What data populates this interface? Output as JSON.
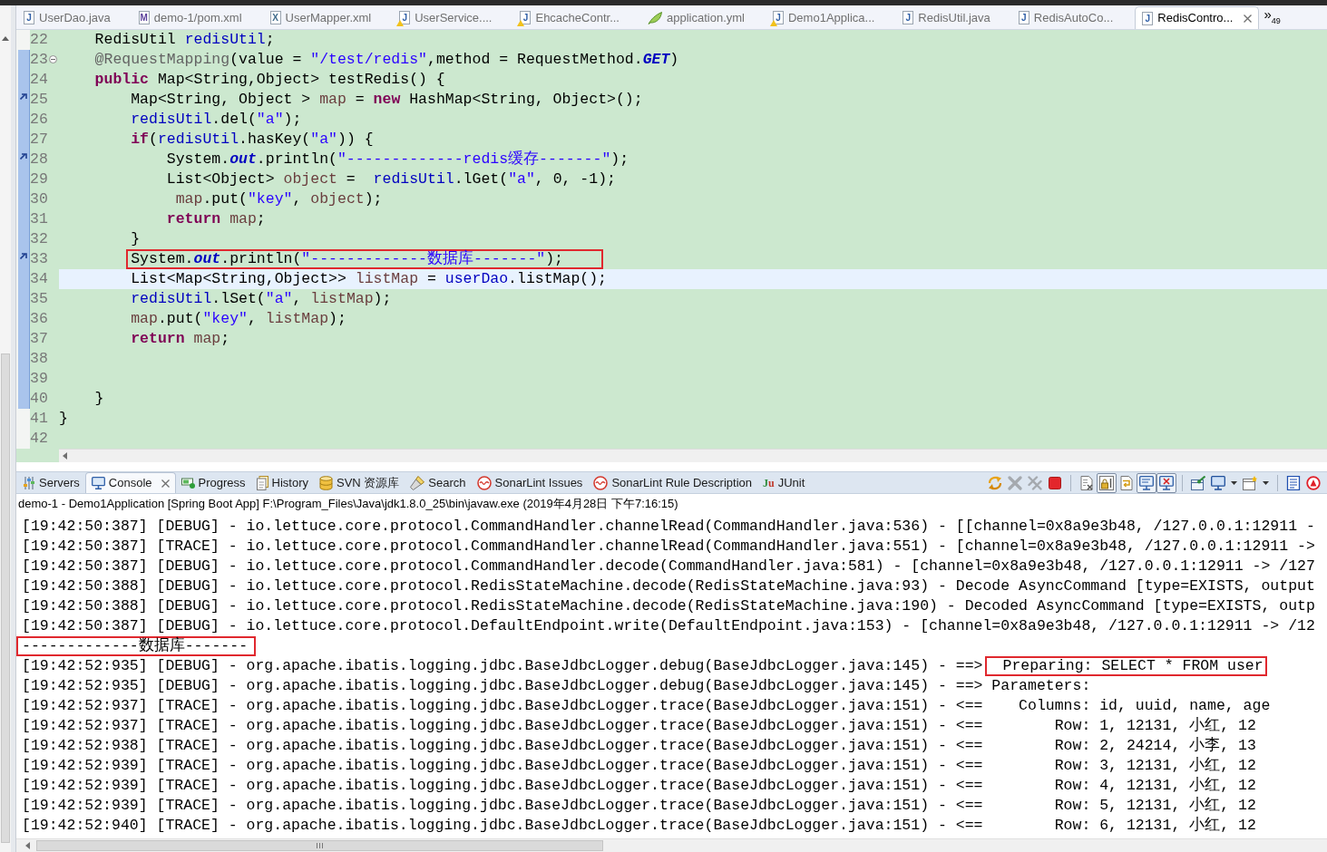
{
  "editor_tabs": [
    {
      "label": "UserDao.java",
      "kind": "java",
      "icon_letter": "J",
      "warning": false,
      "selected": false
    },
    {
      "label": "demo-1/pom.xml",
      "kind": "maven",
      "icon_letter": "M",
      "warning": false,
      "selected": false
    },
    {
      "label": "UserMapper.xml",
      "kind": "xml",
      "icon_letter": "X",
      "warning": false,
      "selected": false
    },
    {
      "label": "UserService....",
      "kind": "java",
      "icon_letter": "J",
      "warning": true,
      "selected": false
    },
    {
      "label": "EhcacheContr...",
      "kind": "java",
      "icon_letter": "J",
      "warning": true,
      "selected": false
    },
    {
      "label": "application.yml",
      "kind": "yaml",
      "warning": false,
      "selected": false
    },
    {
      "label": "Demo1Applica...",
      "kind": "java",
      "icon_letter": "J",
      "warning": true,
      "selected": false
    },
    {
      "label": "RedisUtil.java",
      "kind": "java",
      "icon_letter": "J",
      "warning": false,
      "selected": false
    },
    {
      "label": "RedisAutoCo...",
      "kind": "java",
      "icon_letter": "J",
      "warning": false,
      "selected": false
    },
    {
      "label": "RedisContro...",
      "kind": "java",
      "icon_letter": "J",
      "warning": false,
      "selected": true
    }
  ],
  "tab_overflow": {
    "symbol": "»",
    "count": "49"
  },
  "editor": {
    "lines": [
      {
        "number": "22",
        "kind": "plain",
        "changed": false,
        "current": false,
        "boxed": false,
        "tokens": [
          {
            "kind": "plain",
            "text": "    RedisUtil "
          },
          {
            "kind": "field",
            "text": "redisUtil"
          },
          {
            "kind": "plain",
            "text": ";"
          }
        ]
      },
      {
        "number": "23",
        "kind": "fold",
        "changed": true,
        "current": false,
        "boxed": false,
        "tokens": [
          {
            "kind": "annotation",
            "text": "    @RequestMapping"
          },
          {
            "kind": "plain",
            "text": "(value = "
          },
          {
            "kind": "string",
            "text": "\"/test/redis\""
          },
          {
            "kind": "plain",
            "text": ",method = RequestMethod."
          },
          {
            "kind": "static",
            "text": "GET"
          },
          {
            "kind": "plain",
            "text": ")"
          }
        ]
      },
      {
        "number": "24",
        "kind": "plain",
        "changed": true,
        "current": false,
        "boxed": false,
        "tokens": [
          {
            "kind": "keyword",
            "text": "    public"
          },
          {
            "kind": "plain",
            "text": " Map<String,Object> testRedis() {"
          }
        ]
      },
      {
        "number": "25",
        "kind": "arrow",
        "changed": true,
        "current": false,
        "boxed": false,
        "tokens": [
          {
            "kind": "plain",
            "text": "        Map<String, Object > "
          },
          {
            "kind": "local",
            "text": "map"
          },
          {
            "kind": "plain",
            "text": " = "
          },
          {
            "kind": "keyword",
            "text": "new"
          },
          {
            "kind": "plain",
            "text": " HashMap<String, Object>();"
          }
        ]
      },
      {
        "number": "26",
        "kind": "plain",
        "changed": true,
        "current": false,
        "boxed": false,
        "tokens": [
          {
            "kind": "field",
            "text": "        redisUtil"
          },
          {
            "kind": "plain",
            "text": ".del("
          },
          {
            "kind": "string",
            "text": "\"a\""
          },
          {
            "kind": "plain",
            "text": ");"
          }
        ]
      },
      {
        "number": "27",
        "kind": "plain",
        "changed": true,
        "current": false,
        "boxed": false,
        "tokens": [
          {
            "kind": "keyword",
            "text": "        if"
          },
          {
            "kind": "plain",
            "text": "("
          },
          {
            "kind": "field",
            "text": "redisUtil"
          },
          {
            "kind": "plain",
            "text": ".hasKey("
          },
          {
            "kind": "string",
            "text": "\"a\""
          },
          {
            "kind": "plain",
            "text": ")) {"
          }
        ]
      },
      {
        "number": "28",
        "kind": "arrow",
        "changed": true,
        "current": false,
        "boxed": false,
        "tokens": [
          {
            "kind": "plain",
            "text": "            System."
          },
          {
            "kind": "static",
            "text": "out"
          },
          {
            "kind": "plain",
            "text": ".println("
          },
          {
            "kind": "string",
            "text": "\"-------------redis缓存-------\""
          },
          {
            "kind": "plain",
            "text": ");"
          }
        ]
      },
      {
        "number": "29",
        "kind": "plain",
        "changed": true,
        "current": false,
        "boxed": false,
        "tokens": [
          {
            "kind": "plain",
            "text": "            List<Object> "
          },
          {
            "kind": "local",
            "text": "object"
          },
          {
            "kind": "plain",
            "text": " =  "
          },
          {
            "kind": "field",
            "text": "redisUtil"
          },
          {
            "kind": "plain",
            "text": ".lGet("
          },
          {
            "kind": "string",
            "text": "\"a\""
          },
          {
            "kind": "plain",
            "text": ", 0, -1);"
          }
        ]
      },
      {
        "number": "30",
        "kind": "plain",
        "changed": true,
        "current": false,
        "boxed": false,
        "tokens": [
          {
            "kind": "local",
            "text": "             map"
          },
          {
            "kind": "plain",
            "text": ".put("
          },
          {
            "kind": "string",
            "text": "\"key\""
          },
          {
            "kind": "plain",
            "text": ", "
          },
          {
            "kind": "local",
            "text": "object"
          },
          {
            "kind": "plain",
            "text": ");"
          }
        ]
      },
      {
        "number": "31",
        "kind": "plain",
        "changed": true,
        "current": false,
        "boxed": false,
        "tokens": [
          {
            "kind": "keyword",
            "text": "            return"
          },
          {
            "kind": "local",
            "text": " map"
          },
          {
            "kind": "plain",
            "text": ";"
          }
        ]
      },
      {
        "number": "32",
        "kind": "plain",
        "changed": true,
        "current": false,
        "boxed": false,
        "tokens": [
          {
            "kind": "plain",
            "text": "        }"
          }
        ]
      },
      {
        "number": "33",
        "kind": "arrow",
        "changed": true,
        "current": false,
        "boxed": true,
        "tokens": [
          {
            "kind": "plain",
            "text": "        System."
          },
          {
            "kind": "static",
            "text": "out"
          },
          {
            "kind": "plain",
            "text": ".println("
          },
          {
            "kind": "string",
            "text": "\"-------------数据库-------\""
          },
          {
            "kind": "plain",
            "text": ");"
          }
        ]
      },
      {
        "number": "34",
        "kind": "plain",
        "changed": true,
        "current": true,
        "boxed": false,
        "tokens": [
          {
            "kind": "plain",
            "text": "        List<Map<String,Object>> "
          },
          {
            "kind": "local",
            "text": "listMap"
          },
          {
            "kind": "plain",
            "text": " = "
          },
          {
            "kind": "field",
            "text": "userDao"
          },
          {
            "kind": "plain",
            "text": ".listMap();"
          }
        ]
      },
      {
        "number": "35",
        "kind": "plain",
        "changed": true,
        "current": false,
        "boxed": false,
        "tokens": [
          {
            "kind": "field",
            "text": "        redisUtil"
          },
          {
            "kind": "plain",
            "text": ".lSet("
          },
          {
            "kind": "string",
            "text": "\"a\""
          },
          {
            "kind": "plain",
            "text": ", "
          },
          {
            "kind": "local",
            "text": "listMap"
          },
          {
            "kind": "plain",
            "text": ");"
          }
        ]
      },
      {
        "number": "36",
        "kind": "plain",
        "changed": true,
        "current": false,
        "boxed": false,
        "tokens": [
          {
            "kind": "local",
            "text": "        map"
          },
          {
            "kind": "plain",
            "text": ".put("
          },
          {
            "kind": "string",
            "text": "\"key\""
          },
          {
            "kind": "plain",
            "text": ", "
          },
          {
            "kind": "local",
            "text": "listMap"
          },
          {
            "kind": "plain",
            "text": ");"
          }
        ]
      },
      {
        "number": "37",
        "kind": "plain",
        "changed": true,
        "current": false,
        "boxed": false,
        "tokens": [
          {
            "kind": "keyword",
            "text": "        return"
          },
          {
            "kind": "local",
            "text": " map"
          },
          {
            "kind": "plain",
            "text": ";"
          }
        ]
      },
      {
        "number": "38",
        "kind": "plain",
        "changed": true,
        "current": false,
        "boxed": false
      },
      {
        "number": "39",
        "kind": "plain",
        "changed": true,
        "current": false,
        "boxed": false
      },
      {
        "number": "40",
        "kind": "plain",
        "changed": true,
        "current": false,
        "boxed": false,
        "tokens": [
          {
            "kind": "plain",
            "text": "    }"
          }
        ]
      },
      {
        "number": "41",
        "kind": "plain",
        "changed": false,
        "current": false,
        "boxed": false,
        "tokens": [
          {
            "kind": "plain",
            "text": "}"
          }
        ]
      },
      {
        "number": "42",
        "kind": "plain",
        "changed": false,
        "current": false,
        "boxed": false
      }
    ]
  },
  "console_view": {
    "tabs": [
      {
        "label": "Servers",
        "kind": "servers",
        "selected": false
      },
      {
        "label": "Console",
        "kind": "console",
        "selected": true
      },
      {
        "label": "Progress",
        "kind": "progress",
        "selected": false
      },
      {
        "label": "History",
        "kind": "history",
        "selected": false
      },
      {
        "label": "SVN 资源库",
        "kind": "svn",
        "selected": false
      },
      {
        "label": "Search",
        "kind": "search",
        "selected": false
      },
      {
        "label": "SonarLint Issues",
        "kind": "sonarlint",
        "selected": false
      },
      {
        "label": "SonarLint Rule Description",
        "kind": "sonarlint",
        "selected": false
      },
      {
        "label": "JUnit",
        "kind": "junit",
        "logo_text": "Ju",
        "selected": false
      }
    ],
    "toolbar": [
      {
        "kind": "link",
        "pressed": false,
        "disabled": false,
        "dropdown": false
      },
      {
        "kind": "remove",
        "pressed": false,
        "disabled": true,
        "dropdown": false
      },
      {
        "kind": "remove-all",
        "pressed": false,
        "disabled": true,
        "dropdown": false
      },
      {
        "kind": "terminate",
        "pressed": false,
        "disabled": false,
        "dropdown": false
      },
      {
        "kind": "separator"
      },
      {
        "kind": "clear",
        "pressed": false,
        "disabled": false,
        "dropdown": false
      },
      {
        "kind": "scroll-lock",
        "pressed": true,
        "disabled": false,
        "dropdown": false
      },
      {
        "kind": "word-wrap",
        "pressed": false,
        "disabled": false,
        "dropdown": false
      },
      {
        "kind": "show-stdout",
        "pressed": true,
        "disabled": false,
        "dropdown": false
      },
      {
        "kind": "show-stderr",
        "pressed": true,
        "disabled": false,
        "dropdown": false
      },
      {
        "kind": "separator"
      },
      {
        "kind": "pin",
        "pressed": false,
        "disabled": false,
        "dropdown": false
      },
      {
        "kind": "display",
        "pressed": false,
        "disabled": false,
        "dropdown": true
      },
      {
        "kind": "new-console",
        "pressed": false,
        "disabled": false,
        "dropdown": true
      },
      {
        "kind": "separator"
      },
      {
        "kind": "doc",
        "pressed": false,
        "disabled": false,
        "dropdown": false
      },
      {
        "kind": "sonar",
        "pressed": false,
        "disabled": false,
        "dropdown": false
      }
    ],
    "title": "demo-1 - Demo1Application [Spring Boot App] F:\\Program_Files\\Java\\jdk1.8.0_25\\bin\\javaw.exe (2019年4月28日 下午7:16:15)",
    "lines": [
      {
        "parts": [
          {
            "text": "[19:42:50:387] [DEBUG] - io.lettuce.core.protocol.CommandHandler.channelRead(CommandHandler.java:536) - [[channel=0x8a9e3b48, /127.0.0.1:12911 -",
            "boxed": false
          }
        ]
      },
      {
        "parts": [
          {
            "text": "[19:42:50:387] [TRACE] - io.lettuce.core.protocol.CommandHandler.channelRead(CommandHandler.java:551) - [channel=0x8a9e3b48, /127.0.0.1:12911 ->",
            "boxed": false
          }
        ]
      },
      {
        "parts": [
          {
            "text": "[19:42:50:387] [DEBUG] - io.lettuce.core.protocol.CommandHandler.decode(CommandHandler.java:581) - [channel=0x8a9e3b48, /127.0.0.1:12911 -> /127",
            "boxed": false
          }
        ]
      },
      {
        "parts": [
          {
            "text": "[19:42:50:388] [DEBUG] - io.lettuce.core.protocol.RedisStateMachine.decode(RedisStateMachine.java:93) - Decode AsyncCommand [type=EXISTS, output",
            "boxed": false
          }
        ]
      },
      {
        "parts": [
          {
            "text": "[19:42:50:388] [DEBUG] - io.lettuce.core.protocol.RedisStateMachine.decode(RedisStateMachine.java:190) - Decoded AsyncCommand [type=EXISTS, outp",
            "boxed": false
          }
        ]
      },
      {
        "parts": [
          {
            "text": "[19:42:50:387] [DEBUG] - io.lettuce.core.protocol.DefaultEndpoint.write(DefaultEndpoint.java:153) - [channel=0x8a9e3b48, /127.0.0.1:12911 -> /12",
            "boxed": false
          }
        ]
      },
      {
        "parts": [
          {
            "text": "-------------数据库-------",
            "boxed": true
          }
        ]
      },
      {
        "parts": [
          {
            "text": "[19:42:52:935] [DEBUG] - org.apache.ibatis.logging.jdbc.BaseJdbcLogger.debug(BaseJdbcLogger.java:145) - ==>",
            "boxed": false
          },
          {
            "text": "Preparing: SELECT * FROM user",
            "boxed": true
          }
        ]
      },
      {
        "parts": [
          {
            "text": "[19:42:52:935] [DEBUG] - org.apache.ibatis.logging.jdbc.BaseJdbcLogger.debug(BaseJdbcLogger.java:145) - ==> Parameters:",
            "boxed": false
          }
        ]
      },
      {
        "parts": [
          {
            "text": "[19:42:52:937] [TRACE] - org.apache.ibatis.logging.jdbc.BaseJdbcLogger.trace(BaseJdbcLogger.java:151) - <==    Columns: id, uuid, name, age",
            "boxed": false
          }
        ]
      },
      {
        "parts": [
          {
            "text": "[19:42:52:937] [TRACE] - org.apache.ibatis.logging.jdbc.BaseJdbcLogger.trace(BaseJdbcLogger.java:151) - <==        Row: 1, 12131, 小红, 12",
            "boxed": false
          }
        ]
      },
      {
        "parts": [
          {
            "text": "[19:42:52:938] [TRACE] - org.apache.ibatis.logging.jdbc.BaseJdbcLogger.trace(BaseJdbcLogger.java:151) - <==        Row: 2, 24214, 小李, 13",
            "boxed": false
          }
        ]
      },
      {
        "parts": [
          {
            "text": "[19:42:52:939] [TRACE] - org.apache.ibatis.logging.jdbc.BaseJdbcLogger.trace(BaseJdbcLogger.java:151) - <==        Row: 3, 12131, 小红, 12",
            "boxed": false
          }
        ]
      },
      {
        "parts": [
          {
            "text": "[19:42:52:939] [TRACE] - org.apache.ibatis.logging.jdbc.BaseJdbcLogger.trace(BaseJdbcLogger.java:151) - <==        Row: 4, 12131, 小红, 12",
            "boxed": false
          }
        ]
      },
      {
        "parts": [
          {
            "text": "[19:42:52:939] [TRACE] - org.apache.ibatis.logging.jdbc.BaseJdbcLogger.trace(BaseJdbcLogger.java:151) - <==        Row: 5, 12131, 小红, 12",
            "boxed": false
          }
        ]
      },
      {
        "parts": [
          {
            "text": "[19:42:52:940] [TRACE] - org.apache.ibatis.logging.jdbc.BaseJdbcLogger.trace(BaseJdbcLogger.java:151) - <==        Row: 6, 12131, 小红, 12",
            "boxed": false
          }
        ]
      }
    ]
  }
}
